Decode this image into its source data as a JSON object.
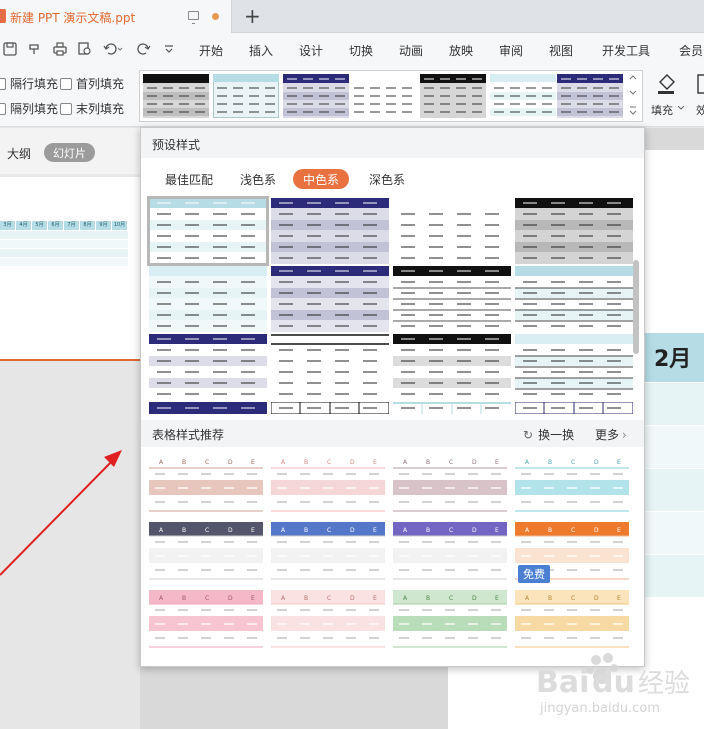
{
  "window": {
    "tab_title": "新建 PPT 演示文稿.ppt",
    "new_tab_label": "+"
  },
  "menu": {
    "items": [
      "开始",
      "插入",
      "设计",
      "切换",
      "动画",
      "放映",
      "审阅",
      "视图",
      "开发工具",
      "会员"
    ]
  },
  "ribbon": {
    "checkboxes": [
      {
        "label": "隔行填充",
        "checked": false
      },
      {
        "label": "首列填充",
        "checked": false
      },
      {
        "label": "隔列填充",
        "checked": false
      },
      {
        "label": "末列填充",
        "checked": false
      }
    ],
    "fill_label": "填充",
    "effect_label": "效"
  },
  "left_pane": {
    "tab_outline": "大纲",
    "tab_slides": "幻灯片",
    "mini_table_header": [
      "3月",
      "4月",
      "5月",
      "6月",
      "7月",
      "8月",
      "9月",
      "10月"
    ]
  },
  "slide": {
    "table_header": "2月"
  },
  "panel": {
    "title": "预设样式",
    "filter_tabs": [
      "最佳匹配",
      "浅色系",
      "中色系",
      "深色系"
    ],
    "active_filter": "中色系",
    "section2_title": "表格样式推荐",
    "refresh_label": "换一换",
    "more_label": "更多",
    "free_badge": "免费",
    "rec_header_letters": [
      "A",
      "B",
      "C",
      "D",
      "E"
    ]
  },
  "watermark": {
    "brand": "Bai du 经验",
    "url": "jingyan.baidu.com"
  },
  "colors": {
    "accent_orange": "#e8713f",
    "navy": "#2b2b7a",
    "teal_light": "#b6dde6",
    "arrow_red": "#e02020",
    "badge_blue": "#4a7fd4"
  }
}
